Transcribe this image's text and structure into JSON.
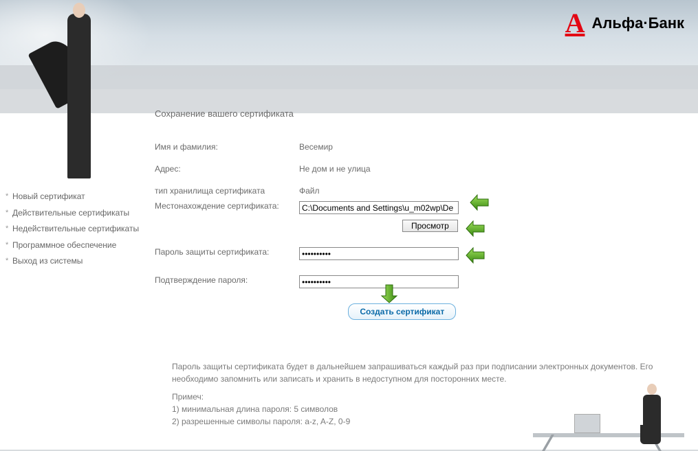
{
  "brand": {
    "letter": "А",
    "name": "Альфа·Банк"
  },
  "page_title": "Сохранение вашего сертификата",
  "sidebar": {
    "items": [
      {
        "label": "Новый сертификат"
      },
      {
        "label": "Действительные сертификаты"
      },
      {
        "label": "Недействительные сертификаты"
      },
      {
        "label": "Программное обеспечение"
      },
      {
        "label": "Выход из системы"
      }
    ]
  },
  "form": {
    "name_label": "Имя и фамилия:",
    "name_value": "Весемир",
    "address_label": "Адрес:",
    "address_value": "Не дом и не улица",
    "storage_type_label": "тип хранилища сертификата",
    "storage_type_value": "Файл",
    "location_label": "Местонахождение сертификата:",
    "location_value": "C:\\Documents and Settings\\u_m02wp\\De",
    "browse_label": "Просмотр",
    "password_label": "Пароль защиты сертификата:",
    "password_value": "••••••••••",
    "confirm_label": "Подтверждение пароля:",
    "confirm_value": "••••••••••",
    "create_label": "Создать сертификат"
  },
  "notes": {
    "intro": "Пароль защиты сертификата будет в дальнейшем запрашиваться каждый раз при подписании электронных документов. Его необходимо запомнить или записать и хранить в недоступном для посторонних месте.",
    "heading": "Примеч:",
    "line1": "1) минимальная длина пароля: 5 символов",
    "line2": "2) разрешенные символы пароля: a-z, A-Z, 0-9"
  }
}
